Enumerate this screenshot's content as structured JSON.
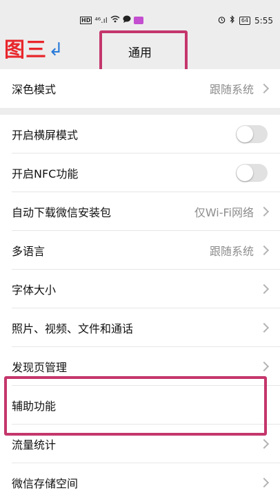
{
  "status_bar": {
    "hd": "HD",
    "signal": "⁴⁶.ıl",
    "time": "5:55",
    "battery": "64"
  },
  "annotation": {
    "tag_text": "图三",
    "tag_arrow": "↲"
  },
  "header": {
    "title": "通用"
  },
  "settings": {
    "dark_mode": {
      "label": "深色模式",
      "value": "跟随系统"
    },
    "landscape": {
      "label": "开启横屏模式",
      "enabled": false
    },
    "nfc": {
      "label": "开启NFC功能",
      "enabled": false
    },
    "auto_download": {
      "label": "自动下载微信安装包",
      "value": "仅Wi-Fi网络"
    },
    "language": {
      "label": "多语言",
      "value": "跟随系统"
    },
    "font_size": {
      "label": "字体大小"
    },
    "media": {
      "label": "照片、视频、文件和通话"
    },
    "discover": {
      "label": "发现页管理"
    },
    "accessibility": {
      "label": "辅助功能"
    },
    "data_usage": {
      "label": "流量统计"
    },
    "storage": {
      "label": "微信存储空间"
    }
  },
  "colors": {
    "highlight": "#c4366b",
    "annotation_red": "#e8262b",
    "annotation_blue": "#2a7bd9",
    "background": "#ededed"
  }
}
